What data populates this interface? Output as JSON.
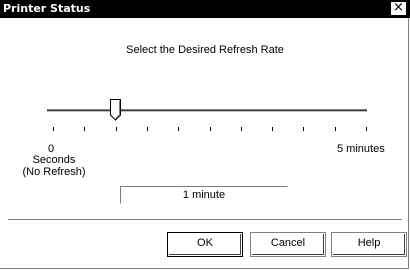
{
  "window": {
    "title": "Printer Status",
    "close_glyph": "×"
  },
  "dialog": {
    "prompt": "Select the Desired Refresh Rate",
    "slider": {
      "min_label": "0",
      "min_caption": "Seconds",
      "min_note": "(No Refresh)",
      "max_label": "5 minutes",
      "position_fraction": 0.2,
      "tick_count": 11
    },
    "current_value": "1 minute"
  },
  "buttons": {
    "ok": "OK",
    "cancel": "Cancel",
    "help": "Help"
  }
}
